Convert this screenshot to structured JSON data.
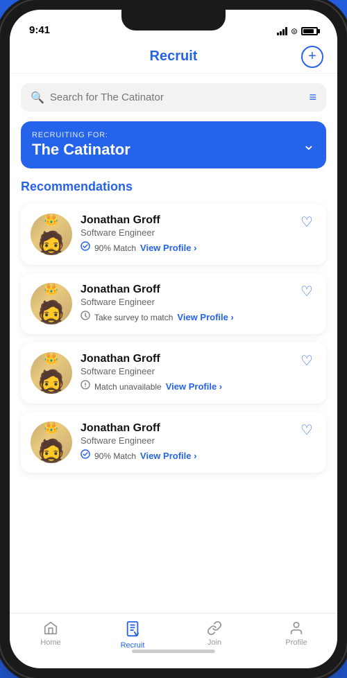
{
  "status": {
    "time": "9:41"
  },
  "header": {
    "title": "Recruit",
    "add_button_label": "+"
  },
  "search": {
    "placeholder": "Search for The Catinator"
  },
  "recruiting": {
    "label": "RECRUITING FOR:",
    "name": "The Catinator"
  },
  "recommendations": {
    "section_title": "Recommendations",
    "candidates": [
      {
        "name": "Jonathan Groff",
        "role": "Software Engineer",
        "match_icon": "check",
        "match_text": "90% Match",
        "view_profile_label": "View Profile"
      },
      {
        "name": "Jonathan Groff",
        "role": "Software Engineer",
        "match_icon": "clock",
        "match_text": "Take survey to match",
        "view_profile_label": "View Profile"
      },
      {
        "name": "Jonathan Groff",
        "role": "Software Engineer",
        "match_icon": "warning",
        "match_text": "Match unavailable",
        "view_profile_label": "View Profile"
      },
      {
        "name": "Jonathan Groff",
        "role": "Software Engineer",
        "match_icon": "check",
        "match_text": "90% Match",
        "view_profile_label": "View Profile"
      }
    ]
  },
  "nav": {
    "items": [
      {
        "label": "Home",
        "icon": "home",
        "active": false
      },
      {
        "label": "Recruit",
        "icon": "recruit",
        "active": true
      },
      {
        "label": "Join",
        "icon": "join",
        "active": false
      },
      {
        "label": "Profile",
        "icon": "profile",
        "active": false
      }
    ]
  }
}
